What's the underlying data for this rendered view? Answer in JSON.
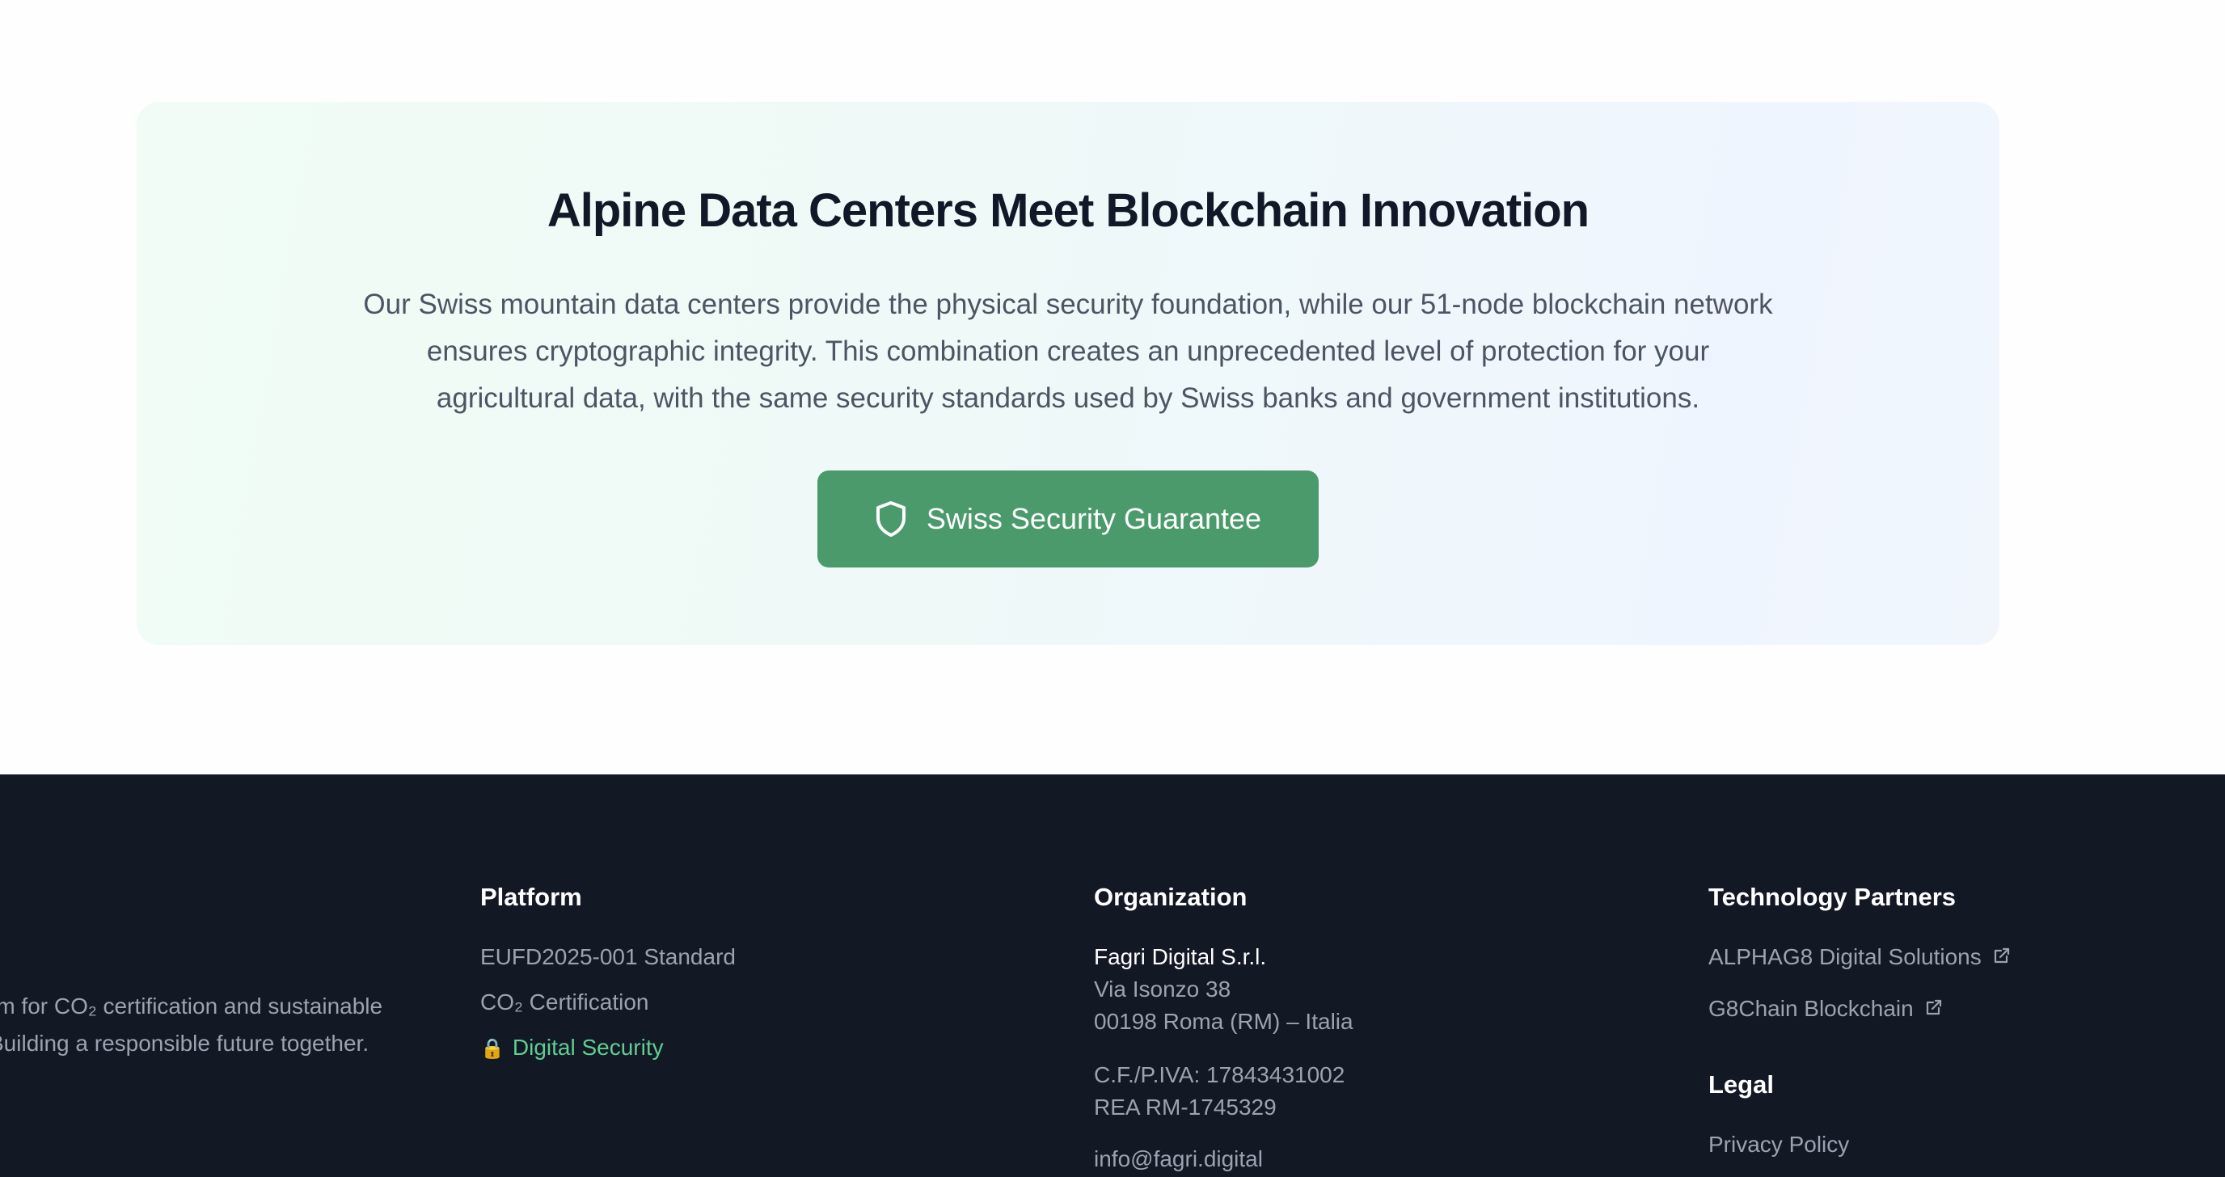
{
  "hero": {
    "title": "Alpine Data Centers Meet Blockchain Innovation",
    "description": "Our Swiss mountain data centers provide the physical security foundation, while our 51-node blockchain network ensures cryptographic integrity. This combination creates an unprecedented level of protection for your agricultural data, with the same security standards used by Swiss banks and government institutions.",
    "button_label": "Swiss Security Guarantee",
    "button_icon": "shield-icon",
    "colors": {
      "button": "#4a9a6c",
      "title": "#111827",
      "text": "#4b5563"
    }
  },
  "footer": {
    "background": "#131825",
    "brand": {
      "line1": "rm for CO₂ certification and sustainable",
      "line2": "Building a responsible future together."
    },
    "platform": {
      "heading": "Platform",
      "links": [
        "EUFD2025-001 Standard",
        "CO₂ Certification",
        "Digital Security"
      ],
      "active_icon": "lock-icon",
      "accent": "#5fce92"
    },
    "organization": {
      "heading": "Organization",
      "company": "Fagri Digital S.r.l.",
      "address_line1": "Via Isonzo 38",
      "address_line2": "00198 Roma (RM) – Italia",
      "tax_id": "C.F./P.IVA: 17843431002",
      "rea": "REA RM-1745329",
      "email": "info@fagri.digital"
    },
    "technology_partners": {
      "heading": "Technology Partners",
      "links": [
        "ALPHAG8 Digital Solutions",
        "G8Chain Blockchain"
      ],
      "link_icon": "external-link-icon"
    },
    "legal": {
      "heading": "Legal",
      "links": [
        "Privacy Policy"
      ]
    }
  }
}
